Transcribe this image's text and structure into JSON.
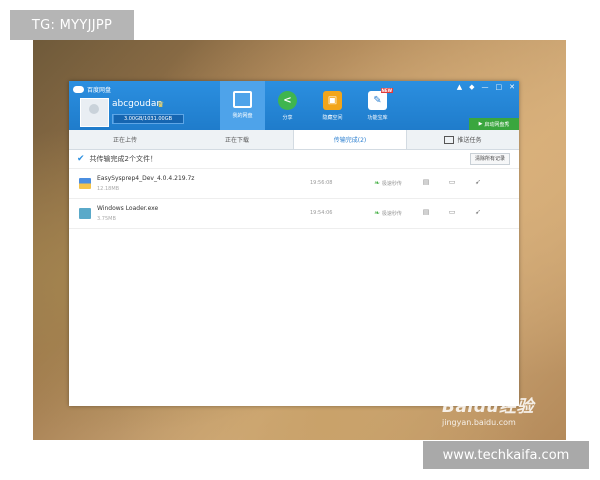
{
  "overlay": {
    "top_tag": "TG: MYYJJPP",
    "bottom_tag": "www.techkaifa.com",
    "watermark_logo": "Baidu经验",
    "watermark_url": "jingyan.baidu.com"
  },
  "app": {
    "title": "百度网盘",
    "window_controls": [
      "▲",
      "◆",
      "—",
      "□",
      "✕"
    ],
    "user": {
      "name": "abcgoudan",
      "quota_text": "3.00GB/1031.00GB",
      "quota_fraction": 0.003
    },
    "nav": [
      {
        "label": "我的网盘",
        "icon": "disk-icon",
        "active": true
      },
      {
        "label": "分享",
        "icon": "share-icon",
        "active": false
      },
      {
        "label": "隐藏空间",
        "icon": "lock-icon",
        "active": false
      },
      {
        "label": "功能宝库",
        "icon": "toolbox-icon",
        "active": false,
        "badge": "NEW"
      }
    ],
    "green_button_label": "启动网盘秀",
    "tabs": [
      {
        "label": "正在上传",
        "active": false
      },
      {
        "label": "正在下载",
        "active": false
      },
      {
        "label": "传输完成(2)",
        "active": true
      },
      {
        "label": "推送任务",
        "active": false
      }
    ],
    "summary": {
      "text": "共传输完成2个文件！",
      "clear_label": "清除所有记录"
    },
    "files": [
      {
        "name": "EasySysprep4_Dev_4.0.4.219.7z",
        "size": "12.18MB",
        "time": "19:56:08",
        "status": "极速秒传",
        "type": "archive"
      },
      {
        "name": "Windows Loader.exe",
        "size": "3.75MB",
        "time": "19:54:06",
        "status": "极速秒传",
        "type": "exe"
      }
    ],
    "colors": {
      "header_blue": "#1f7ccb",
      "active_tab_blue": "#2b7fd0",
      "green": "#3aa63e"
    }
  }
}
